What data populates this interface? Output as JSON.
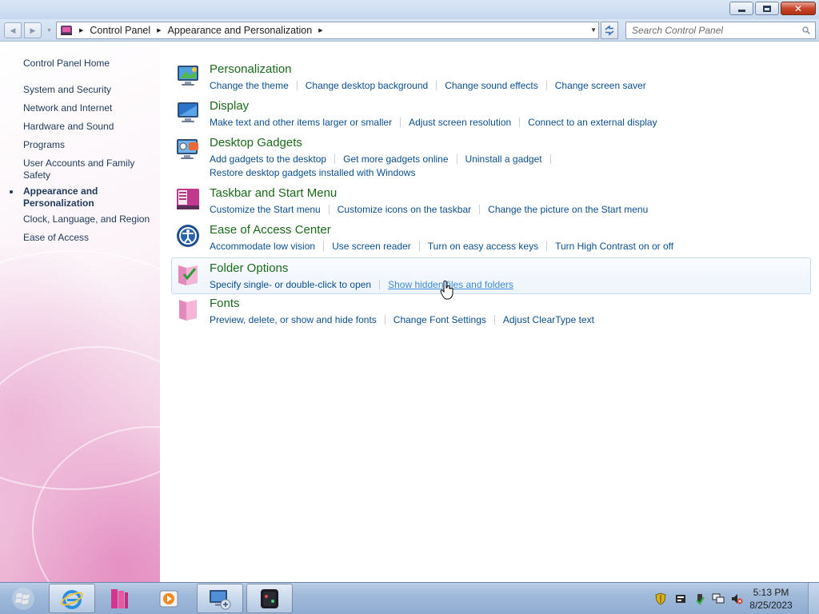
{
  "window": {
    "controls": {
      "close": "✕"
    }
  },
  "address": {
    "crumbs": [
      "Control Panel",
      "Appearance and Personalization"
    ],
    "search_placeholder": "Search Control Panel"
  },
  "sidebar": {
    "home": "Control Panel Home",
    "items": [
      {
        "label": "System and Security"
      },
      {
        "label": "Network and Internet"
      },
      {
        "label": "Hardware and Sound"
      },
      {
        "label": "Programs"
      },
      {
        "label": "User Accounts and Family Safety"
      },
      {
        "label": "Appearance and Personalization",
        "current": true
      },
      {
        "label": "Clock, Language, and Region"
      },
      {
        "label": "Ease of Access"
      }
    ]
  },
  "categories": [
    {
      "title": "Personalization",
      "icon": "personalization-icon",
      "links": [
        "Change the theme",
        "Change desktop background",
        "Change sound effects",
        "Change screen saver"
      ]
    },
    {
      "title": "Display",
      "icon": "display-icon",
      "links": [
        "Make text and other items larger or smaller",
        "Adjust screen resolution",
        "Connect to an external display"
      ]
    },
    {
      "title": "Desktop Gadgets",
      "icon": "desktop-gadgets-icon",
      "links": [
        "Add gadgets to the desktop",
        "Get more gadgets online",
        "Uninstall a gadget",
        "Restore desktop gadgets installed with Windows"
      ]
    },
    {
      "title": "Taskbar and Start Menu",
      "icon": "taskbar-icon",
      "links": [
        "Customize the Start menu",
        "Customize icons on the taskbar",
        "Change the picture on the Start menu"
      ]
    },
    {
      "title": "Ease of Access Center",
      "icon": "ease-of-access-icon",
      "links": [
        "Accommodate low vision",
        "Use screen reader",
        "Turn on easy access keys",
        "Turn High Contrast on or off"
      ]
    },
    {
      "title": "Folder Options",
      "icon": "folder-options-icon",
      "links": [
        "Specify single- or double-click to open",
        "Show hidden files and folders"
      ]
    },
    {
      "title": "Fonts",
      "icon": "fonts-icon",
      "links": [
        "Preview, delete, or show and hide fonts",
        "Change Font Settings",
        "Adjust ClearType text"
      ]
    }
  ],
  "taskbar": {
    "time": "5:13 PM",
    "date": "8/25/2023"
  },
  "colors": {
    "link": "#0b4f8e",
    "category_title": "#1a6b1a",
    "sidebar_text": "#1e395b"
  }
}
